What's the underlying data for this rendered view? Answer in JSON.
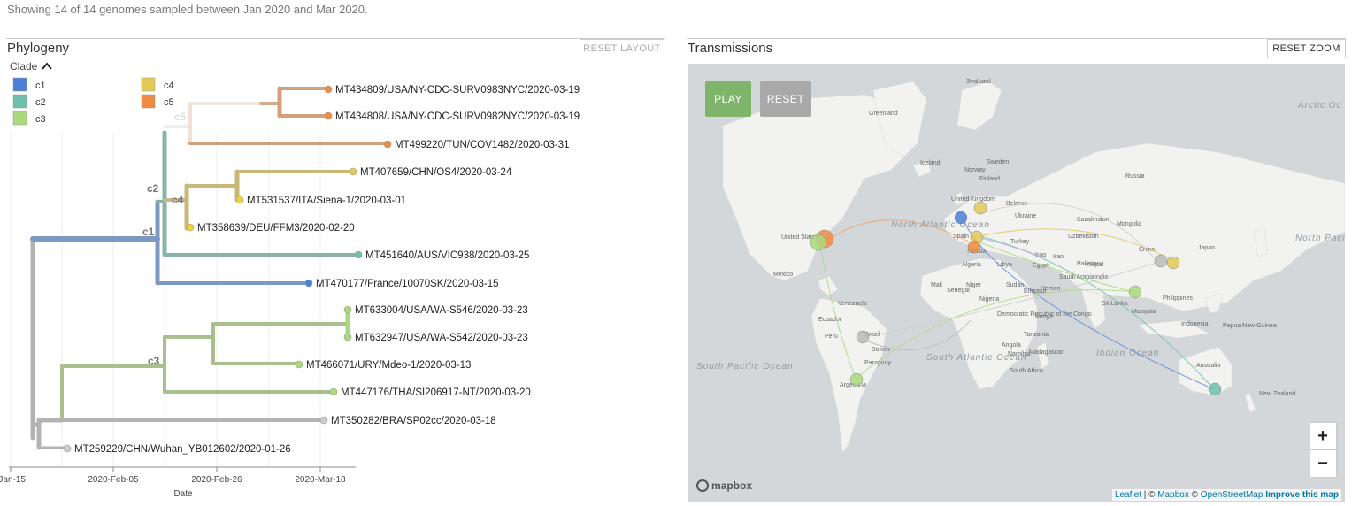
{
  "summary": "Showing 14 of 14 genomes sampled between Jan 2020 and Mar 2020.",
  "phylogeny": {
    "title": "Phylogeny",
    "reset_label": "RESET LAYOUT",
    "clade_toggle": "Clade",
    "legend": [
      {
        "label": "c1",
        "color": "#4c7fd6"
      },
      {
        "label": "c2",
        "color": "#6fbfad"
      },
      {
        "label": "c3",
        "color": "#a9d97c"
      },
      {
        "label": "c4",
        "color": "#e3c957"
      },
      {
        "label": "c5",
        "color": "#f08c3f"
      }
    ],
    "clade_labels": [
      "c5",
      "c2",
      "c4",
      "c1",
      "c3"
    ],
    "tips": [
      {
        "name": "MT434809/USA/NY-CDC-SURV0983NYC/2020-03-19",
        "color": "#f08c3f"
      },
      {
        "name": "MT434808/USA/NY-CDC-SURV0982NYC/2020-03-19",
        "color": "#f08c3f"
      },
      {
        "name": "MT499220/TUN/COV1482/2020-03-31",
        "color": "#f08c3f"
      },
      {
        "name": "MT407659/CHN/OS4/2020-03-24",
        "color": "#e3c957"
      },
      {
        "name": "MT531537/ITA/Siena-1/2020-03-01",
        "color": "#f0d530"
      },
      {
        "name": "MT358639/DEU/FFM3/2020-02-20",
        "color": "#f0d530"
      },
      {
        "name": "MT451640/AUS/VIC938/2020-03-25",
        "color": "#6fbfad"
      },
      {
        "name": "MT470177/France/10070SK/2020-03-15",
        "color": "#4c7fd6"
      },
      {
        "name": "MT633004/USA/WA-S546/2020-03-23",
        "color": "#a9d97c"
      },
      {
        "name": "MT632947/USA/WA-S542/2020-03-23",
        "color": "#a9d97c"
      },
      {
        "name": "MT466071/URY/Mdeo-1/2020-03-13",
        "color": "#a9d97c"
      },
      {
        "name": "MT447176/THA/SI206917-NT/2020-03-20",
        "color": "#a9d97c"
      },
      {
        "name": "MT350282/BRA/SP02cc/2020-03-18",
        "color": "#cccccc"
      },
      {
        "name": "MT259229/CHN/Wuhan_YB012602/2020-01-26",
        "color": "#cccccc"
      }
    ],
    "axis": {
      "ticks": [
        "-Jan-15",
        "2020-Feb-05",
        "2020-Feb-26",
        "2020-Mar-18"
      ],
      "label": "Date"
    }
  },
  "transmissions": {
    "title": "Transmissions",
    "reset_zoom_label": "RESET ZOOM",
    "play_label": "PLAY",
    "reset_label": "RESET",
    "zoom_in": "+",
    "zoom_out": "−",
    "mapbox_logo": "mapbox",
    "attribution": {
      "leaflet": "Leaflet",
      "sep1": " | © ",
      "mapbox": "Mapbox",
      "sep2": " © ",
      "osm": "OpenStreetMap",
      "improve": "Improve this map"
    },
    "map_labels": [
      "Svalbard",
      "Greenland",
      "Iceland",
      "Sweden",
      "Norway",
      "Finland",
      "Russia",
      "United Kingdom",
      "Belarus",
      "Ukraine",
      "Kazakhstan",
      "Mongolia",
      "Uzbekistan",
      "Spain",
      "Turkey",
      "China",
      "Japan",
      "Tunisia",
      "Iraq",
      "Iran",
      "Pakistan",
      "Nepal",
      "Algeria",
      "Libya",
      "Egypt",
      "Saudi Arabia",
      "India",
      "Mali",
      "Niger",
      "Sudan",
      "Yemen",
      "Senegal",
      "Nigeria",
      "Ethiopia",
      "Sri Lanka",
      "Philippines",
      "Malaysia",
      "Indonesia",
      "Papua New Guinea",
      "Democratic Republic of the Congo",
      "Kenya",
      "Tanzania",
      "Angola",
      "Namibia",
      "Madagascar",
      "South Africa",
      "Australia",
      "New Zealand",
      "United States",
      "Mexico",
      "Venezuela",
      "Ecuador",
      "Peru",
      "Bolivia",
      "Brazil",
      "Paraguay",
      "Argentina",
      "North Atlantic Ocean",
      "South Atlantic Ocean",
      "Indian Ocean",
      "North Pacific Ocean",
      "South Pacific Ocean",
      "Arctic Oc"
    ]
  }
}
